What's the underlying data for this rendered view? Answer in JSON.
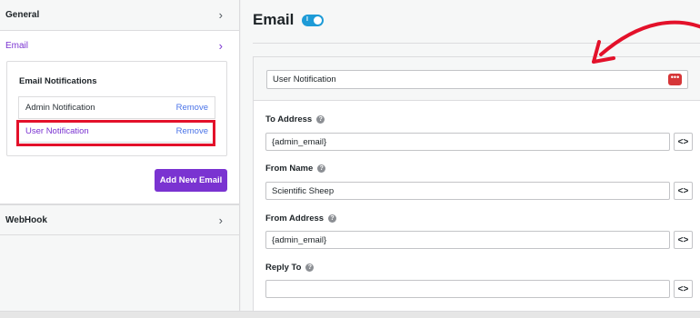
{
  "sidebar": {
    "general_label": "General",
    "email_label": "Email",
    "webhook_label": "WebHook",
    "notifications_title": "Email Notifications",
    "notifications": [
      {
        "name": "Admin Notification",
        "action": "Remove"
      },
      {
        "name": "User Notification",
        "action": "Remove"
      }
    ],
    "add_button": "Add New Email"
  },
  "main": {
    "title": "Email",
    "toggle_tick": "I",
    "notification_name": "User Notification",
    "fields": [
      {
        "label": "To Address",
        "value": "{admin_email}"
      },
      {
        "label": "From Name",
        "value": "Scientific Sheep"
      },
      {
        "label": "From Address",
        "value": "{admin_email}"
      },
      {
        "label": "Reply To",
        "value": ""
      }
    ],
    "tag_button": "<>",
    "help_icon": "?"
  },
  "colors": {
    "accent": "#7a33d1",
    "toggle": "#1e9bd7",
    "highlight": "#e3112a",
    "link": "#4a73e8"
  }
}
